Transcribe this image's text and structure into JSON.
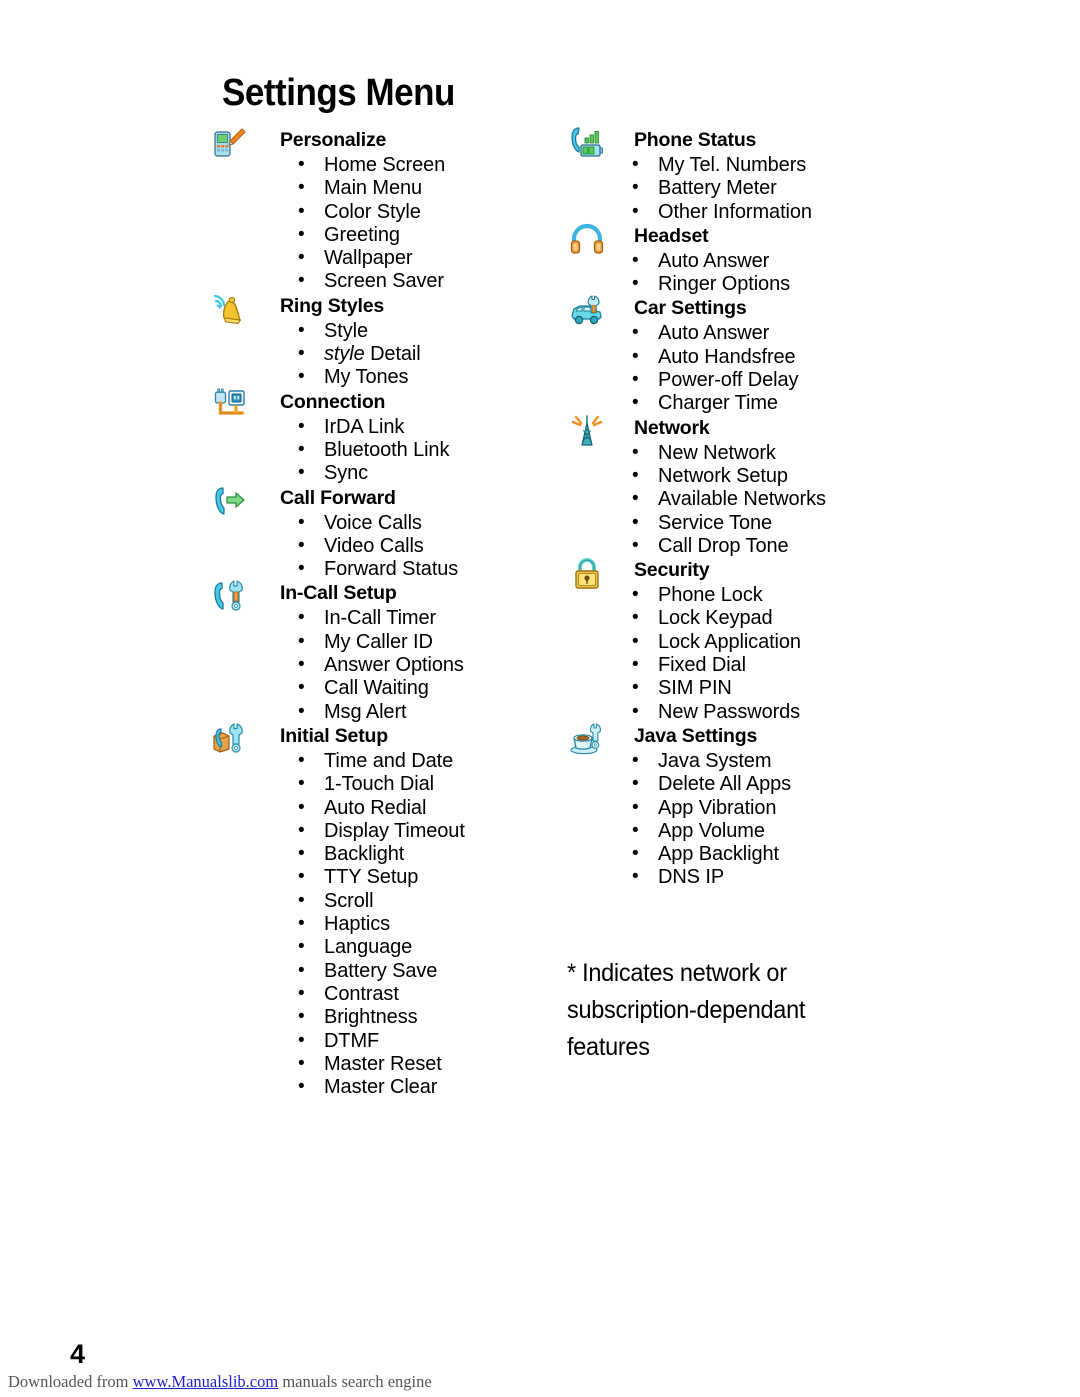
{
  "page": {
    "title": "Settings Menu",
    "page_number": "4",
    "footnote": "* Indicates network or subscription-dependant features"
  },
  "footer": {
    "prefix": "Downloaded from ",
    "link_text": "www.Manualslib.com",
    "suffix": " manuals search engine"
  },
  "columns": {
    "left": [
      {
        "title": "Personalize",
        "icon": "phone-pencil-icon",
        "items": [
          {
            "text": "Home Screen"
          },
          {
            "text": "Main Menu"
          },
          {
            "text": "Color Style"
          },
          {
            "text": "Greeting"
          },
          {
            "text": "Wallpaper"
          },
          {
            "text": "Screen Saver"
          }
        ]
      },
      {
        "title": "Ring Styles",
        "icon": "bell-sound-icon",
        "items": [
          {
            "text": "Style"
          },
          {
            "italic_prefix": "style",
            "text": " Detail"
          },
          {
            "text": "My Tones"
          }
        ]
      },
      {
        "title": "Connection",
        "icon": "plug-socket-icon",
        "items": [
          {
            "text": "IrDA Link"
          },
          {
            "text": "Bluetooth Link"
          },
          {
            "text": "Sync"
          }
        ]
      },
      {
        "title": "Call Forward",
        "icon": "handset-arrow-icon",
        "items": [
          {
            "text": "Voice Calls"
          },
          {
            "text": "Video Calls"
          },
          {
            "text": "Forward Status"
          }
        ]
      },
      {
        "title": "In-Call Setup",
        "icon": "handset-wrench-icon",
        "items": [
          {
            "text": "In-Call Timer"
          },
          {
            "text": "My Caller ID"
          },
          {
            "text": "Answer Options"
          },
          {
            "text": "Call Waiting"
          },
          {
            "text": "Msg Alert"
          }
        ]
      },
      {
        "title": "Initial Setup",
        "icon": "box-handset-wrench-icon",
        "items": [
          {
            "text": "Time and Date"
          },
          {
            "text": "1-Touch Dial"
          },
          {
            "text": "Auto Redial"
          },
          {
            "text": "Display Timeout"
          },
          {
            "text": "Backlight"
          },
          {
            "text": "TTY Setup"
          },
          {
            "text": "Scroll"
          },
          {
            "text": "Haptics"
          },
          {
            "text": "Language"
          },
          {
            "text": "Battery Save"
          },
          {
            "text": "Contrast"
          },
          {
            "text": "Brightness"
          },
          {
            "text": "DTMF"
          },
          {
            "text": "Master Reset"
          },
          {
            "text": "Master Clear"
          }
        ]
      }
    ],
    "right": [
      {
        "title": "Phone Status",
        "icon": "handset-signal-battery-icon",
        "items": [
          {
            "text": "My Tel. Numbers"
          },
          {
            "text": "Battery Meter"
          },
          {
            "text": "Other Information"
          }
        ]
      },
      {
        "title": "Headset",
        "icon": "headphones-icon",
        "items": [
          {
            "text": "Auto Answer"
          },
          {
            "text": "Ringer Options"
          }
        ]
      },
      {
        "title": "Car Settings",
        "icon": "car-wrench-icon",
        "items": [
          {
            "text": "Auto Answer"
          },
          {
            "text": "Auto Handsfree"
          },
          {
            "text": "Power-off Delay"
          },
          {
            "text": "Charger Time"
          }
        ]
      },
      {
        "title": "Network",
        "icon": "antenna-tower-icon",
        "items": [
          {
            "text": "New Network"
          },
          {
            "text": "Network Setup"
          },
          {
            "text": "Available Networks"
          },
          {
            "text": "Service Tone"
          },
          {
            "text": "Call Drop Tone"
          }
        ]
      },
      {
        "title": "Security",
        "icon": "padlock-icon",
        "items": [
          {
            "text": "Phone Lock"
          },
          {
            "text": "Lock Keypad"
          },
          {
            "text": "Lock Application"
          },
          {
            "text": "Fixed Dial"
          },
          {
            "text": "SIM PIN"
          },
          {
            "text": "New Passwords"
          }
        ]
      },
      {
        "title": "Java Settings",
        "icon": "coffee-wrench-icon",
        "items": [
          {
            "text": "Java System"
          },
          {
            "text": "Delete All Apps"
          },
          {
            "text": "App Vibration"
          },
          {
            "text": "App Volume"
          },
          {
            "text": "App Backlight"
          },
          {
            "text": "DNS IP"
          }
        ]
      }
    ]
  },
  "colors": {
    "text": "#000000",
    "link": "#2222cc",
    "footer_text": "#555555",
    "icon_cyan": "#38c6e0",
    "icon_orange": "#f0881f",
    "icon_gold": "#e8b93c",
    "icon_green": "#5fc26a",
    "icon_teal": "#2a9ea8",
    "background": "#ffffff"
  }
}
